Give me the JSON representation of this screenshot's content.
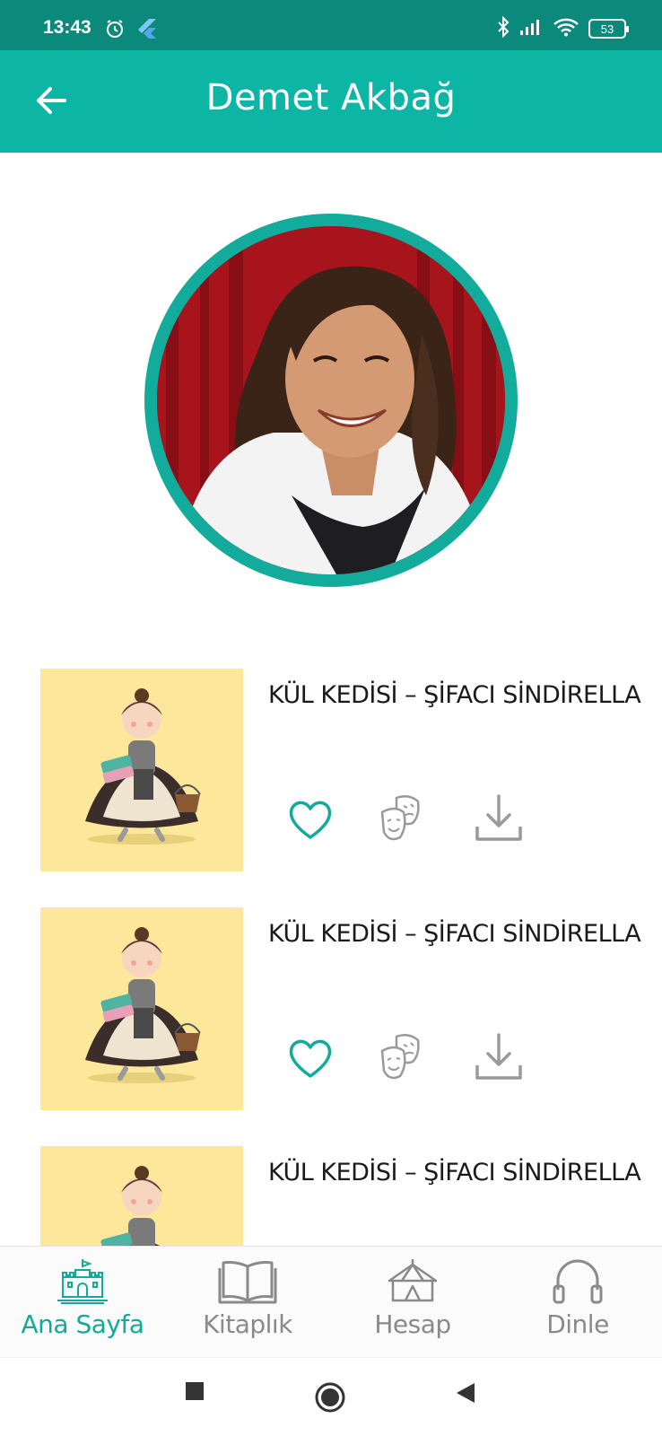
{
  "status_bar": {
    "time": "13:43",
    "battery": "53",
    "icons": [
      "alarm-icon",
      "flutter-icon",
      "bluetooth-icon",
      "signal-icon",
      "wifi-icon",
      "battery-icon"
    ]
  },
  "app_bar": {
    "title": "Demet Akbağ",
    "back_icon": "arrow-left-icon",
    "background": "#0db5a5"
  },
  "profile": {
    "avatar_ring_color": "#12ab9c"
  },
  "books": [
    {
      "title": "KÜL KEDİSİ – ŞİFACI SİNDİRELLA",
      "actions": [
        "heart-icon",
        "theater-masks-icon",
        "download-icon"
      ]
    },
    {
      "title": "KÜL KEDİSİ – ŞİFACI SİNDİRELLA",
      "actions": [
        "heart-icon",
        "theater-masks-icon",
        "download-icon"
      ]
    },
    {
      "title": "KÜL KEDİSİ – ŞİFACI SİNDİRELLA",
      "actions": [
        "heart-icon",
        "theater-masks-icon",
        "download-icon"
      ]
    }
  ],
  "bottom_nav": {
    "items": [
      {
        "label": "Ana Sayfa",
        "icon": "castle-icon",
        "active": true
      },
      {
        "label": "Kitaplık",
        "icon": "book-icon",
        "active": false
      },
      {
        "label": "Hesap",
        "icon": "circus-tent-icon",
        "active": false
      },
      {
        "label": "Dinle",
        "icon": "headphones-icon",
        "active": false
      }
    ]
  },
  "colors": {
    "accent": "#11ab9c",
    "status_bar": "#0b8a7c",
    "cover_bg": "#fde79a",
    "inactive": "#8a8a8a"
  }
}
